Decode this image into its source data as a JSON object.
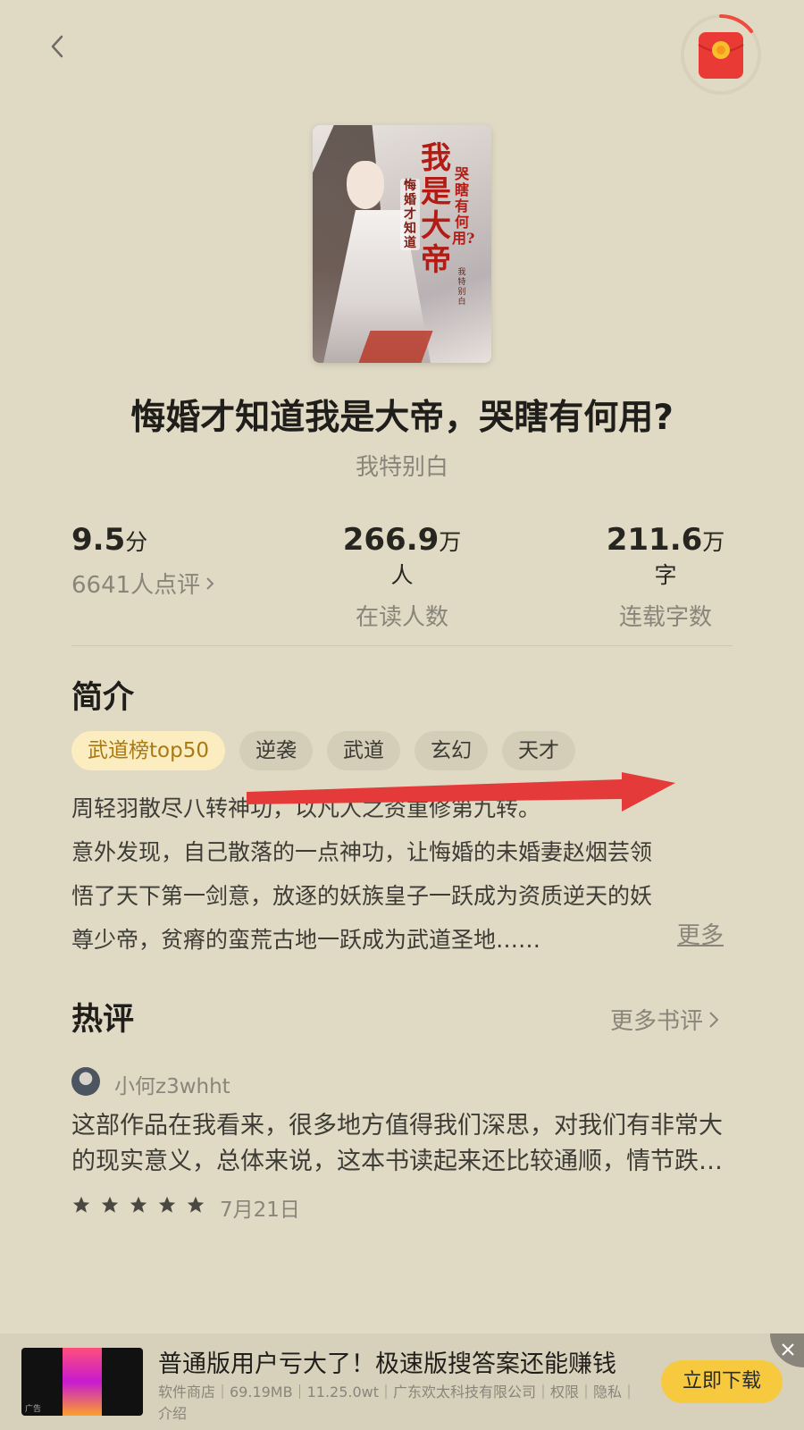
{
  "header": {
    "back_icon": "chevron-left-icon",
    "reward_icon": "red-packet-icon"
  },
  "book": {
    "title": "悔婚才知道我是大帝，哭瞎有何用?",
    "author": "我特别白",
    "cover": {
      "main_title": "我是大帝",
      "sub_title": "哭瞎有何用?",
      "left_title": "悔婚才知道",
      "author_tag": "我特别白"
    }
  },
  "stats": {
    "rating": {
      "value": "9.5",
      "unit": "分",
      "label": "6641人点评"
    },
    "readers": {
      "value": "266.9",
      "unit": "万人",
      "label": "在读人数"
    },
    "words": {
      "value": "211.6",
      "unit": "万字",
      "label": "连载字数"
    }
  },
  "intro": {
    "heading": "简介",
    "tags": [
      "武道榜top50",
      "逆袭",
      "武道",
      "玄幻",
      "天才"
    ],
    "lines": [
      "周轻羽散尽八转神功，以凡人之资重修第九转。",
      "意外发现，自己散落的一点神功，让悔婚的未婚妻赵烟芸领",
      "悟了天下第一剑意，放逐的妖族皇子一跃成为资质逆天的妖",
      "尊少帝，贫瘠的蛮荒古地一跃成为武道圣地……"
    ],
    "more": "更多"
  },
  "reviews": {
    "heading": "热评",
    "more": "更多书评",
    "items": [
      {
        "user": "小何z3whht",
        "text": "这部作品在我看来，很多地方值得我们深思，对我们有非常大的现实意义，总体来说，这本书读起来还比较通顺，情节跌宕起伏",
        "stars": 5,
        "date": "7月21日"
      }
    ]
  },
  "ad": {
    "title": "普通版用户亏大了！极速版搜答案还能赚钱",
    "meta": "软件商店｜69.19MB｜11.25.0wt｜广东欢太科技有限公司｜权限｜隐私｜介绍",
    "button": "立即下载",
    "badge": "广告",
    "close_icon": "close-icon"
  },
  "colors": {
    "background": "#e0dac5",
    "accent_red": "#e53a3a",
    "tag_highlight": "#fbedbf",
    "button_yellow": "#f6c93e"
  }
}
